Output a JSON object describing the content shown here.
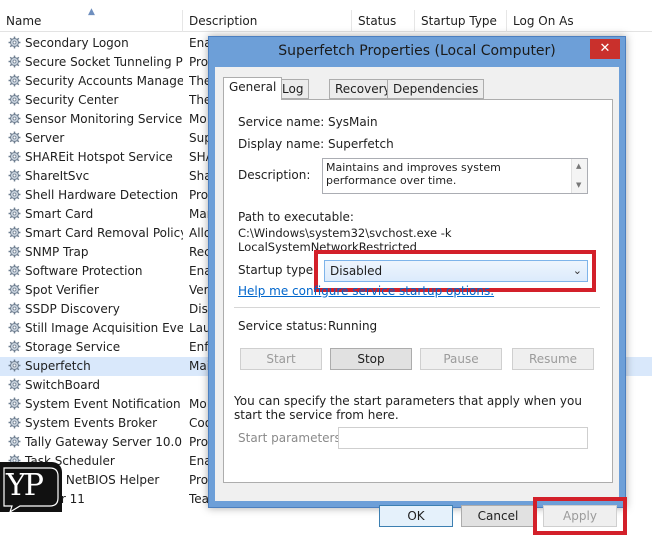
{
  "list": {
    "columns": [
      "Name",
      "Description",
      "Status",
      "Startup Type",
      "Log On As"
    ],
    "rows": [
      {
        "name": "Secondary Logon",
        "desc": "Ena"
      },
      {
        "name": "Secure Socket Tunneling Pr...",
        "desc": "Prov"
      },
      {
        "name": "Security Accounts Manager",
        "desc": "The"
      },
      {
        "name": "Security Center",
        "desc": "The"
      },
      {
        "name": "Sensor Monitoring Service",
        "desc": "Mo"
      },
      {
        "name": "Server",
        "desc": "Sup"
      },
      {
        "name": "SHAREit Hotspot Service",
        "desc": "SHA"
      },
      {
        "name": "ShareItSvc",
        "desc": "Shar"
      },
      {
        "name": "Shell Hardware Detection",
        "desc": "Prov"
      },
      {
        "name": "Smart Card",
        "desc": "Man"
      },
      {
        "name": "Smart Card Removal Policy",
        "desc": "Allo"
      },
      {
        "name": "SNMP Trap",
        "desc": "Rec"
      },
      {
        "name": "Software Protection",
        "desc": "Ena"
      },
      {
        "name": "Spot Verifier",
        "desc": "Veri"
      },
      {
        "name": "SSDP Discovery",
        "desc": "Disc"
      },
      {
        "name": "Still Image Acquisition Events",
        "desc": "Lau"
      },
      {
        "name": "Storage Service",
        "desc": "Enfo"
      },
      {
        "name": "Superfetch",
        "desc": "Mai"
      },
      {
        "name": "SwitchBoard",
        "desc": ""
      },
      {
        "name": "System Event Notification S...",
        "desc": "Mo"
      },
      {
        "name": "System Events Broker",
        "desc": "Coo"
      },
      {
        "name": "Tally Gateway Server 10.0",
        "desc": "Prov"
      },
      {
        "name": "Task Scheduler",
        "desc": "Ena"
      },
      {
        "name": "TCP/IP NetBIOS Helper",
        "desc": "Prov"
      },
      {
        "name": "Viewer 11",
        "desc": "Tea"
      }
    ],
    "selected_row": "Superfetch"
  },
  "dialog": {
    "title": "Superfetch Properties (Local Computer)",
    "close_glyph": "✕",
    "tabs": [
      "General",
      "Log On",
      "Recovery",
      "Dependencies"
    ],
    "active_tab": "General",
    "service_name_label": "Service name:",
    "service_name": "SysMain",
    "display_name_label": "Display name:",
    "display_name": "Superfetch",
    "description_label": "Description:",
    "description": "Maintains and improves system performance over time.",
    "path_label": "Path to executable:",
    "path": "C:\\Windows\\system32\\svchost.exe -k LocalSystemNetworkRestricted",
    "startup_type_label": "Startup type:",
    "startup_type": "Disabled",
    "help_link": "Help me configure service startup options.",
    "status_label": "Service status:",
    "status": "Running",
    "buttons": {
      "start": "Start",
      "stop": "Stop",
      "pause": "Pause",
      "resume": "Resume"
    },
    "note": "You can specify the start parameters that apply when you start the service from here.",
    "start_params_label": "Start parameters:",
    "footer": {
      "ok": "OK",
      "cancel": "Cancel",
      "apply": "Apply"
    }
  },
  "colors": {
    "dialog_frame": "#6d9fd8",
    "close_button": "#c9302c",
    "highlight_box": "#d3202a",
    "link": "#0066cc",
    "selected_row": "#d9e8fb"
  },
  "watermark": {
    "text": "YP"
  }
}
